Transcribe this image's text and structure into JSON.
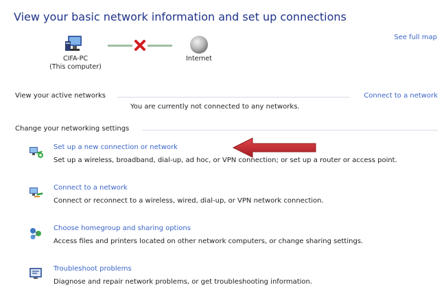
{
  "header": {
    "title": "View your basic network information and set up connections",
    "see_full_map": "See full map"
  },
  "network_map": {
    "computer_name": "CIFA-PC",
    "computer_sub": "(This computer)",
    "internet_label": "Internet",
    "status": "disconnected",
    "icons": {
      "computer": "computer-icon",
      "link_status": "red-x-icon",
      "internet": "globe-icon"
    }
  },
  "active_networks": {
    "header": "View your active networks",
    "connect_link": "Connect to a network",
    "message": "You are currently not connected to any networks."
  },
  "settings": {
    "header": "Change your networking settings",
    "tasks": [
      {
        "title": "Set up a new connection or network",
        "description": "Set up a wireless, broadband, dial-up, ad hoc, or VPN connection; or set up a router or access point.",
        "icon": "new-connection-icon"
      },
      {
        "title": "Connect to a network",
        "description": "Connect or reconnect to a wireless, wired, dial-up, or VPN network connection.",
        "icon": "connect-network-icon"
      },
      {
        "title": "Choose homegroup and sharing options",
        "description": "Access files and printers located on other network computers, or change sharing settings.",
        "icon": "homegroup-icon"
      },
      {
        "title": "Troubleshoot problems",
        "description": "Diagnose and repair network problems, or get troubleshooting information.",
        "icon": "troubleshoot-icon"
      }
    ]
  },
  "colors": {
    "title": "#1e3287",
    "link": "#3a64c8",
    "arrow": "#c0272d",
    "error_x": "#d21e1e"
  }
}
